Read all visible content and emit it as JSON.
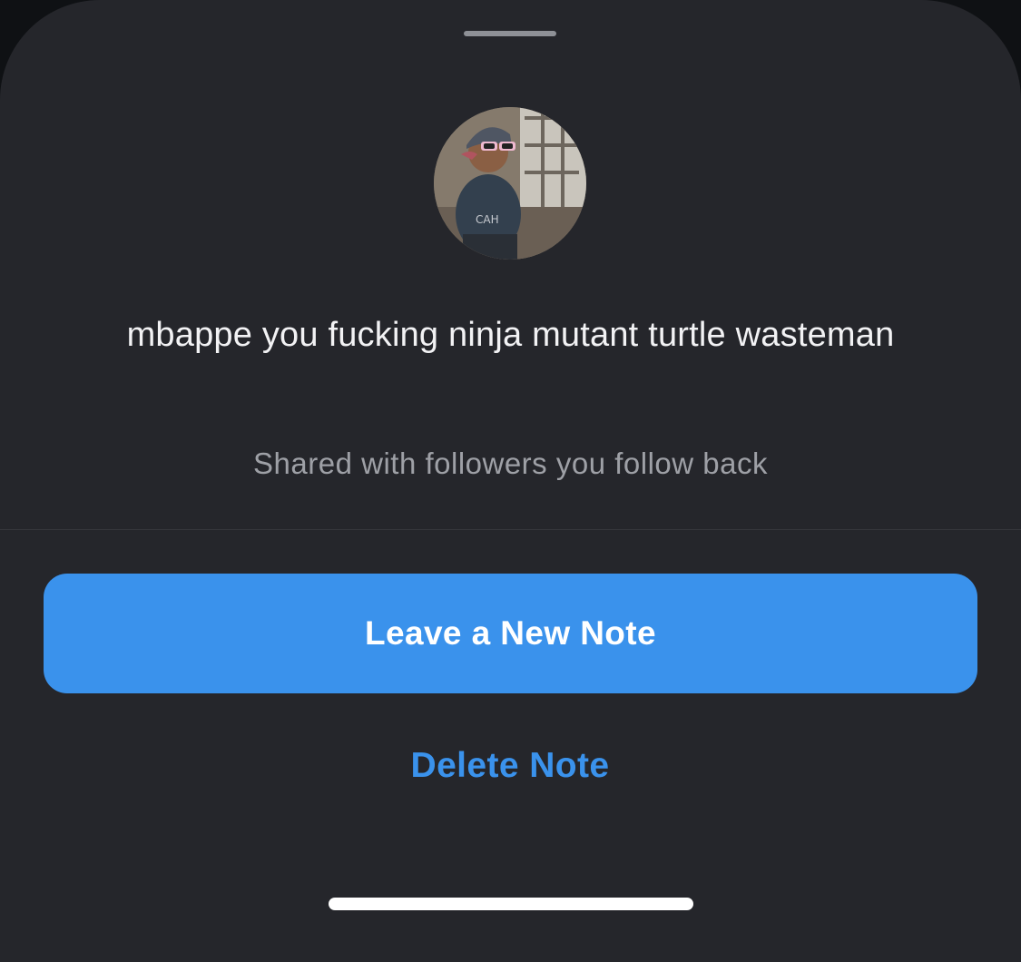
{
  "note": {
    "text": "mbappe you fucking ninja mutant turtle wasteman",
    "audience": "Shared with followers you follow back"
  },
  "actions": {
    "primary_label": "Leave a New Note",
    "delete_label": "Delete Note"
  },
  "colors": {
    "sheet_background": "#25262b",
    "accent": "#3a92ec",
    "primary_text": "#f2f2f4",
    "secondary_text": "#9ea0a6"
  }
}
